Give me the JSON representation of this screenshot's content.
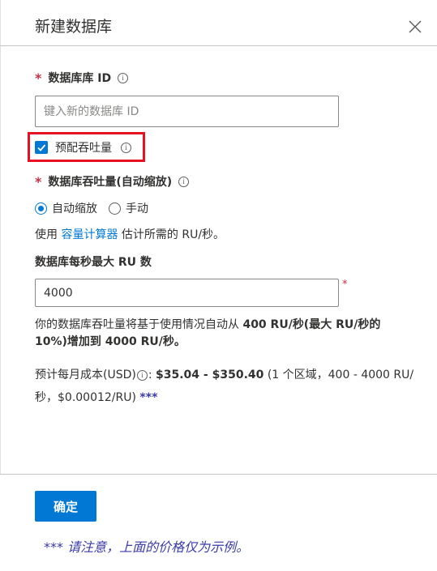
{
  "dialog": {
    "title": "新建数据库",
    "close_icon": "close-icon"
  },
  "database_id": {
    "required_mark": "*",
    "label": "数据库库 ID",
    "info_icon": "info-icon",
    "placeholder": "键入新的数据库 ID",
    "value": ""
  },
  "provision": {
    "checked": true,
    "label": "预配吞吐量",
    "info_icon": "info-icon"
  },
  "throughput": {
    "required_mark": "*",
    "label": "数据库吞吐量(自动缩放)",
    "options": [
      {
        "label": "自动缩放",
        "selected": true
      },
      {
        "label": "手动",
        "selected": false
      }
    ],
    "use_prefix": "使用",
    "use_link": "容量计算器",
    "use_suffix": "估计所需的 RU/秒。"
  },
  "max_ru": {
    "label": "数据库每秒最大 RU 数",
    "value": "4000",
    "required_mark": "*"
  },
  "description": {
    "prefix": "你的数据库吞吐量将基于使用情况自动从",
    "bold": "400 RU/秒(最大 RU/秒的 10%)增加到 4000 RU/秒。"
  },
  "cost": {
    "prefix": "预计每月成本(USD)",
    "info_icon": "info-icon",
    "colon": ":",
    "range": "$35.04 - $350.40",
    "detail": "(1 个区域，400 - 4000 RU/秒，$0.00012/RU)",
    "stars": "***"
  },
  "footer": {
    "ok_label": "确定",
    "note": "*** 请注意，上面的价格仅为示例。"
  },
  "colors": {
    "accent": "#0078d4",
    "required": "#c4314b",
    "highlight": "#e81123",
    "note": "#3a3aa6"
  }
}
